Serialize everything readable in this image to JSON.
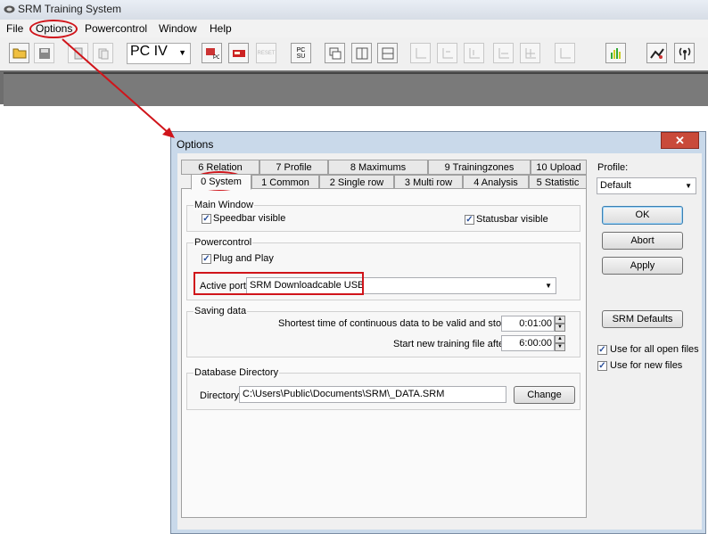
{
  "app": {
    "title": "SRM Training System",
    "menu": [
      "File",
      "Options",
      "Powercontrol",
      "Window",
      "Help"
    ],
    "device": "PC IV",
    "toolbar_reset": "RESET",
    "toolbar_pc": "PC",
    "toolbar_su": "SU"
  },
  "dialog": {
    "title": "Options",
    "tabs_back": [
      "6 Relation",
      "7 Profile",
      "8 Maximums",
      "9 Trainingzones",
      "10 Upload"
    ],
    "tabs_front": [
      "0 System",
      "1 Common",
      "2 Single row",
      "3 Multi row",
      "4 Analysis",
      "5 Statistic"
    ],
    "main_window": {
      "label": "Main Window",
      "speedbar": "Speedbar visible",
      "statusbar": "Statusbar visible"
    },
    "powercontrol": {
      "label": "Powercontrol",
      "plug_and_play": "Plug and Play",
      "active_port_label": "Active port",
      "active_port_value": "SRM Downloadcable USB"
    },
    "saving": {
      "label": "Saving data",
      "shortest_label": "Shortest time of continuous data to be valid and stored:",
      "shortest_value": "0:01:00",
      "new_file_label": "Start new training file after",
      "new_file_value": "6:00:00"
    },
    "database": {
      "label": "Database Directory",
      "directory_label": "Directory",
      "directory_value": "C:\\Users\\Public\\Documents\\SRM\\_DATA.SRM",
      "change_button": "Change"
    },
    "profile_label": "Profile:",
    "profile_value": "Default",
    "ok_button": "OK",
    "abort_button": "Abort",
    "apply_button": "Apply",
    "srm_defaults_button": "SRM Defaults",
    "use_all_files": "Use for all open files",
    "use_new_files": "Use for new files",
    "close_glyph": "✕"
  },
  "colors": {
    "annotation": "#d0141a",
    "dialog_frame": "#c9d9ea"
  }
}
